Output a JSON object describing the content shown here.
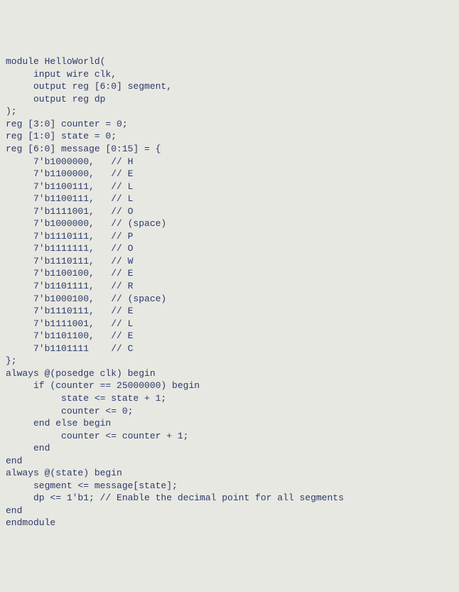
{
  "code": {
    "lines": [
      "module HelloWorld(",
      "     input wire clk,",
      "     output reg [6:0] segment,",
      "     output reg dp",
      ");",
      "",
      "reg [3:0] counter = 0;",
      "reg [1:0] state = 0;",
      "reg [6:0] message [0:15] = {",
      "     7'b1000000,   // H",
      "     7'b1100000,   // E",
      "     7'b1100111,   // L",
      "     7'b1100111,   // L",
      "     7'b1111001,   // O",
      "     7'b1000000,   // (space)",
      "     7'b1110111,   // P",
      "     7'b1111111,   // O",
      "     7'b1110111,   // W",
      "     7'b1100100,   // E",
      "     7'b1101111,   // R",
      "     7'b1000100,   // (space)",
      "     7'b1110111,   // E",
      "     7'b1111001,   // L",
      "     7'b1101100,   // E",
      "     7'b1101111    // C",
      "};",
      "",
      "always @(posedge clk) begin",
      "     if (counter == 25000000) begin",
      "          state <= state + 1;",
      "          counter <= 0;",
      "     end else begin",
      "          counter <= counter + 1;",
      "     end",
      "end",
      "",
      "always @(state) begin",
      "     segment <= message[state];",
      "     dp <= 1'b1; // Enable the decimal point for all segments",
      "end",
      "",
      "endmodule"
    ]
  }
}
